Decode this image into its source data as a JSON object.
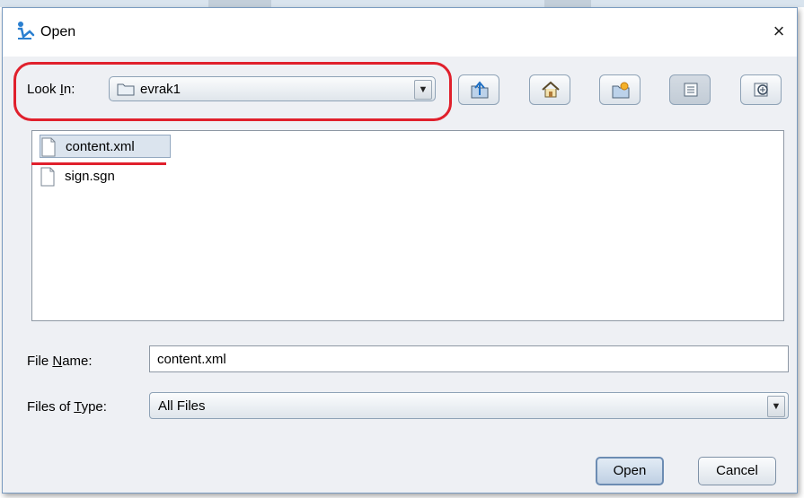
{
  "window": {
    "title": "Open",
    "close_glyph": "×"
  },
  "look_in": {
    "label_pre": "Look ",
    "label_mnemonic": "I",
    "label_post": "n:",
    "value": "evrak1"
  },
  "toolbar": {
    "buttons": [
      {
        "name": "up-one-level-button",
        "icon": "folder-up-icon"
      },
      {
        "name": "home-button",
        "icon": "home-icon"
      },
      {
        "name": "new-folder-button",
        "icon": "new-folder-icon"
      },
      {
        "name": "list-view-button",
        "icon": "list-view-icon",
        "active": true
      },
      {
        "name": "details-view-button",
        "icon": "details-view-icon"
      }
    ]
  },
  "files": [
    {
      "name": "content.xml",
      "selected": true
    },
    {
      "name": "sign.sgn",
      "selected": false
    }
  ],
  "file_name": {
    "label_pre": "File ",
    "label_mnemonic": "N",
    "label_post": "ame:",
    "value": "content.xml"
  },
  "files_of_type": {
    "label_pre": "Files of ",
    "label_mnemonic": "T",
    "label_post": "ype:",
    "value": "All Files"
  },
  "actions": {
    "open": "Open",
    "cancel": "Cancel"
  },
  "colors": {
    "highlight": "#e0202c",
    "selection": "#dbe4ee",
    "panel": "#eef0f4"
  }
}
